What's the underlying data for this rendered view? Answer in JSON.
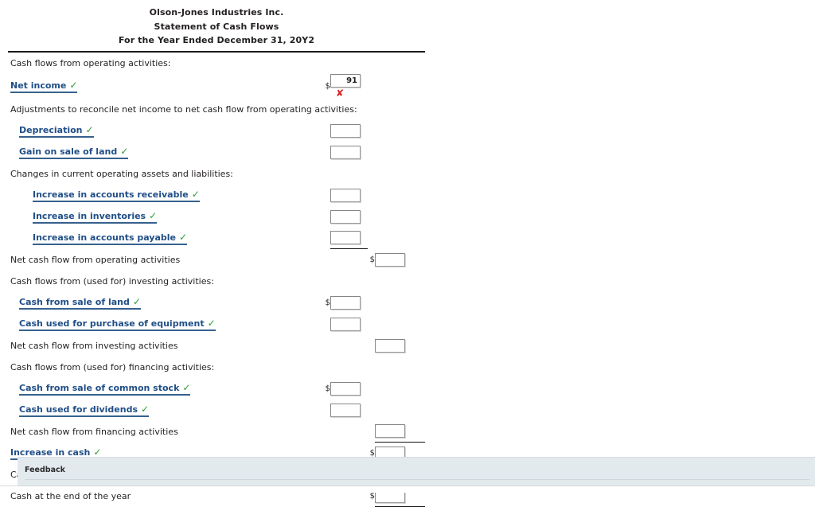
{
  "statement": {
    "company": "Olson-Jones Industries Inc.",
    "report_title": "Statement of Cash Flows",
    "period": "For the Year Ended December 31, 20Y2",
    "rows": [
      {
        "kind": "caption",
        "indent": 0,
        "label": "Cash flows from operating activities:",
        "dollar1": "",
        "amount1": null,
        "dollar2": "",
        "amount2": null
      },
      {
        "kind": "link",
        "indent": 0,
        "label": "Net income",
        "check": "✓",
        "dollar1": "$",
        "amount1": "91",
        "mark": "✘",
        "dollar2": "",
        "amount2": null
      },
      {
        "kind": "caption",
        "indent": 0,
        "label": "Adjustments to reconcile net income to net cash flow from operating activities:",
        "dollar1": "",
        "amount1": null,
        "dollar2": "",
        "amount2": null
      },
      {
        "kind": "link",
        "indent": 1,
        "label": "Depreciation",
        "check": "✓",
        "dollar1": "",
        "amount1": "",
        "dollar2": "",
        "amount2": null
      },
      {
        "kind": "link",
        "indent": 1,
        "label": "Gain on sale of land",
        "check": "✓",
        "dollar1": "",
        "amount1": "",
        "dollar2": "",
        "amount2": null
      },
      {
        "kind": "caption",
        "indent": 0,
        "label": "Changes in current operating assets and liabilities:",
        "dollar1": "",
        "amount1": null,
        "dollar2": "",
        "amount2": null
      },
      {
        "kind": "link",
        "indent": 2,
        "label": "Increase in accounts receivable",
        "check": "✓",
        "dollar1": "",
        "amount1": "",
        "dollar2": "",
        "amount2": null
      },
      {
        "kind": "link",
        "indent": 2,
        "label": "Increase in inventories",
        "check": "✓",
        "dollar1": "",
        "amount1": "",
        "dollar2": "",
        "amount2": null
      },
      {
        "kind": "link",
        "indent": 2,
        "label": "Increase in accounts payable",
        "check": "✓",
        "dollar1": "",
        "amount1": "",
        "dollar2": "",
        "amount2": null,
        "rule1": "single"
      },
      {
        "kind": "caption",
        "indent": 0,
        "label": "Net cash flow from operating activities",
        "dollar1": "",
        "amount1": null,
        "dollar2": "$",
        "amount2": ""
      },
      {
        "kind": "caption",
        "indent": 0,
        "label": "Cash flows from (used for) investing activities:",
        "dollar1": "",
        "amount1": null,
        "dollar2": "",
        "amount2": null
      },
      {
        "kind": "link",
        "indent": 1,
        "label": "Cash from sale of land",
        "check": "✓",
        "dollar1": "$",
        "amount1": "",
        "dollar2": "",
        "amount2": null
      },
      {
        "kind": "link",
        "indent": 1,
        "label": "Cash used for purchase of equipment",
        "check": "✓",
        "dollar1": "",
        "amount1": "",
        "dollar2": "",
        "amount2": null
      },
      {
        "kind": "caption",
        "indent": 0,
        "label": "Net cash flow from investing activities",
        "dollar1": "",
        "amount1": null,
        "dollar2": "",
        "amount2": ""
      },
      {
        "kind": "caption",
        "indent": 0,
        "label": "Cash flows from (used for) financing activities:",
        "dollar1": "",
        "amount1": null,
        "dollar2": "",
        "amount2": null
      },
      {
        "kind": "link",
        "indent": 1,
        "label": "Cash from sale of common stock",
        "check": "✓",
        "dollar1": "$",
        "amount1": "",
        "dollar2": "",
        "amount2": null
      },
      {
        "kind": "link",
        "indent": 1,
        "label": "Cash used for dividends",
        "check": "✓",
        "dollar1": "",
        "amount1": "",
        "dollar2": "",
        "amount2": null
      },
      {
        "kind": "caption",
        "indent": 0,
        "label": "Net cash flow from financing activities",
        "dollar1": "",
        "amount1": null,
        "dollar2": "",
        "amount2": "",
        "rule2": "single"
      },
      {
        "kind": "link",
        "indent": 0,
        "label": "Increase in cash",
        "check": "✓",
        "dollar1": "",
        "amount1": null,
        "dollar2": "$",
        "amount2": ""
      },
      {
        "kind": "caption",
        "indent": 0,
        "label": "Cash at the beginning of the year",
        "dollar1": "",
        "amount1": null,
        "dollar2": "",
        "amount2": "",
        "rule2": "single"
      },
      {
        "kind": "caption",
        "indent": 0,
        "label": "Cash at the end of the year",
        "dollar1": "",
        "amount1": null,
        "dollar2": "$",
        "amount2": "",
        "rule2": "double"
      }
    ]
  },
  "feedback": {
    "title": "Feedback"
  },
  "colors": {
    "link_blue": "#1f4e87",
    "check_green": "#2e9c3a",
    "error_red": "#e02020",
    "feedback_bg": "#e3eaee",
    "rule_black": "#111111"
  },
  "icons": {
    "check": "check-icon",
    "error": "x-mark-icon"
  }
}
